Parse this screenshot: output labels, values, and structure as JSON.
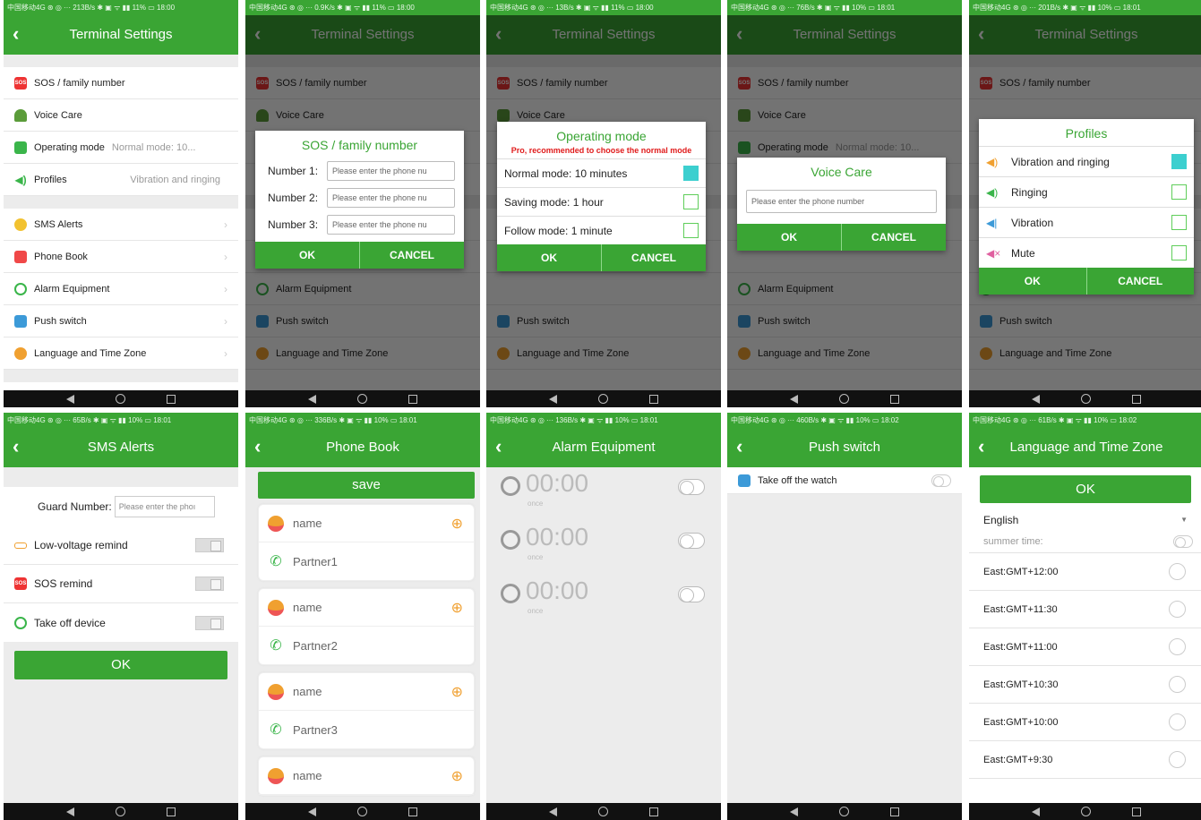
{
  "status": {
    "s1": "中国移动4G ⊛ ◎ ··· 213B/s ✱ ▣ ᯤ ▮▮ 11% ▭ 18:00",
    "s2": "中国移动4G ⊛ ◎ ··· 0.9K/s ✱ ▣ ᯤ ▮▮ 11% ▭ 18:00",
    "s3": "中国移动4G ⊛ ◎ ··· 13B/s ✱ ▣ ᯤ ▮▮ 11% ▭ 18:00",
    "s4": "中国移动4G ⊛ ◎ ··· 76B/s ✱ ▣ ᯤ ▮▮ 10% ▭ 18:01",
    "s5": "中国移动4G ⊛ ◎ ··· 201B/s ✱ ▣ ᯤ ▮▮ 10% ▭ 18:01",
    "s6": "中国移动4G ⊛ ◎ ··· 65B/s ✱ ▣ ᯤ ▮▮ 10% ▭ 18:01",
    "s7": "中国移动4G ⊛ ◎ ··· 336B/s ✱ ▣ ᯤ ▮▮ 10% ▭ 18:01",
    "s8": "中国移动4G ⊛ ◎ ··· 136B/s ✱ ▣ ᯤ ▮▮ 10% ▭ 18:01",
    "s9": "中国移动4G ⊛ ◎ ··· 460B/s ✱ ▣ ᯤ ▮▮ 10% ▭ 18:02",
    "s10": "中国移动4G ⊛ ◎ ··· 61B/s ✱ ▣ ᯤ ▮▮ 10% ▭ 18:02"
  },
  "back": "‹",
  "terminal": {
    "title": "Terminal Settings",
    "items": {
      "sos": "SOS / family number",
      "voice": "Voice Care",
      "mode": "Operating mode",
      "mode_val": "Normal mode: 10...",
      "profiles": "Profiles",
      "profiles_val": "Vibration and ringing",
      "sms": "SMS Alerts",
      "phonebook": "Phone Book",
      "alarm": "Alarm Equipment",
      "push": "Push switch",
      "lang": "Language and Time Zone"
    }
  },
  "sos_dialog": {
    "title": "SOS / family number",
    "n1": "Number 1:",
    "n2": "Number 2:",
    "n3": "Number 3:",
    "placeholder": "Please enter the phone nu",
    "ok": "OK",
    "cancel": "CANCEL"
  },
  "mode_dialog": {
    "title": "Operating mode",
    "warn": "Pro, recommended to choose the normal mode",
    "o1": "Normal mode: 10 minutes",
    "o2": "Saving mode: 1 hour",
    "o3": "Follow mode: 1 minute",
    "ok": "OK",
    "cancel": "CANCEL"
  },
  "voice_dialog": {
    "title": "Voice Care",
    "placeholder": "Please enter the phone number",
    "ok": "OK",
    "cancel": "CANCEL"
  },
  "profiles_dialog": {
    "title": "Profiles",
    "o1": "Vibration and ringing",
    "o2": "Ringing",
    "o3": "Vibration",
    "o4": "Mute",
    "ok": "OK",
    "cancel": "CANCEL"
  },
  "sms": {
    "title": "SMS Alerts",
    "guard": "Guard Number:",
    "guard_ph": "Please enter the phoı",
    "low": "Low-voltage remind",
    "sos": "SOS remind",
    "takeoff": "Take off device",
    "ok": "OK"
  },
  "phonebook": {
    "title": "Phone Book",
    "save": "save",
    "name": "name",
    "p1": "Partner1",
    "p2": "Partner2",
    "p3": "Partner3"
  },
  "alarm": {
    "title": "Alarm Equipment",
    "time": "00:00",
    "once": "once"
  },
  "push": {
    "title": "Push switch",
    "item": "Take off the watch"
  },
  "lang": {
    "title": "Language and Time Zone",
    "ok": "OK",
    "lang": "English",
    "summer": "summer time:",
    "tz": [
      "East:GMT+12:00",
      "East:GMT+11:30",
      "East:GMT+11:00",
      "East:GMT+10:30",
      "East:GMT+10:00",
      "East:GMT+9:30"
    ]
  },
  "colors": {
    "green": "#3aa534",
    "teal": "#3ccfcf",
    "red": "#e01b1b"
  }
}
